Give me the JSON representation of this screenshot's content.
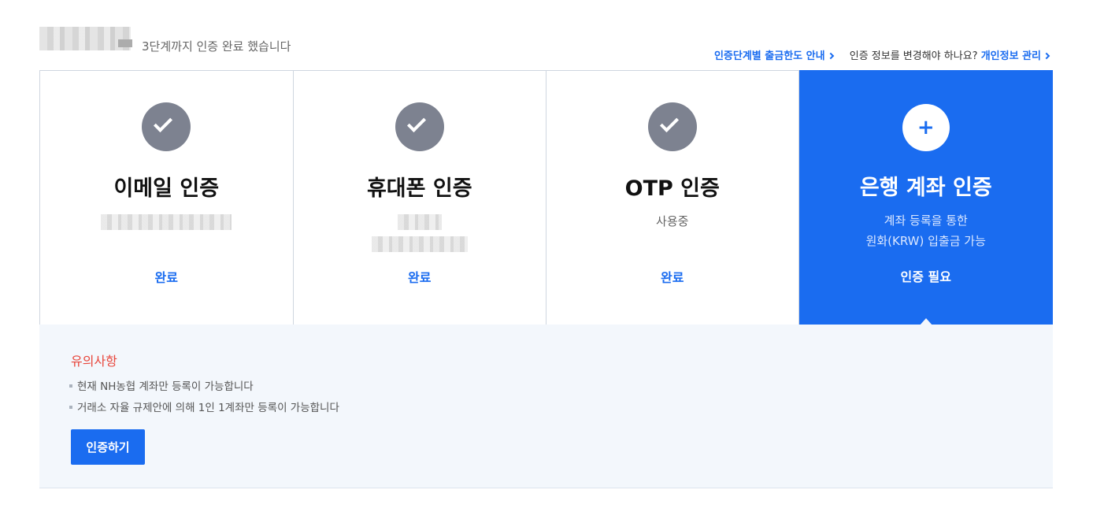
{
  "header": {
    "summary": "3단계까지 인증 완료 했습니다",
    "limit_link": "인증단계별 출금한도 안내",
    "change_prompt": "인증 정보를 변경해야 하나요?",
    "privacy_link": "개인정보 관리"
  },
  "cards": [
    {
      "title": "이메일 인증",
      "status": "완료",
      "icon": "check-icon"
    },
    {
      "title": "휴대폰 인증",
      "status": "완료",
      "icon": "check-icon"
    },
    {
      "title": "OTP 인증",
      "desc": "사용중",
      "status": "완료",
      "icon": "check-icon"
    },
    {
      "title": "은행 계좌 인증",
      "desc_line1": "계좌 등록을 통한",
      "desc_line2": "원화(KRW) 입출금 가능",
      "status": "인증 필요",
      "icon": "plus-icon",
      "plus": "+"
    }
  ],
  "notice": {
    "title": "유의사항",
    "items": [
      "현재 NH농협 계좌만 등록이 가능합니다",
      "거래소 자율 규제안에 의해 1인 1계좌만 등록이 가능합니다"
    ],
    "button": "인증하기"
  },
  "colors": {
    "accent": "#1a6cf0",
    "check_bg": "#7d8290",
    "warning": "#e8463b",
    "notice_bg": "#f3f7fc"
  }
}
